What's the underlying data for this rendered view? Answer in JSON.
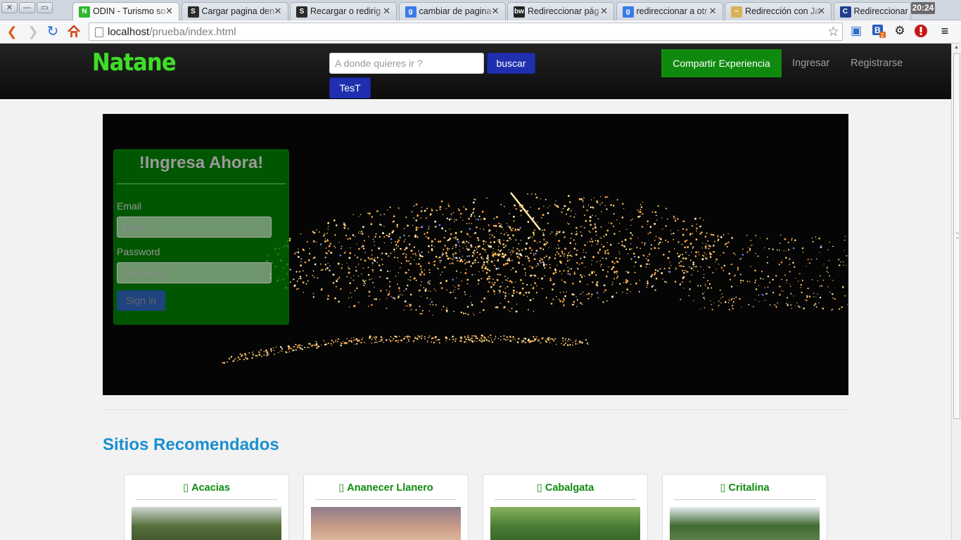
{
  "browser": {
    "tabs": [
      {
        "title": "ODIN - Turismo so",
        "favicon": "N",
        "favicon_color": "#2eb82e",
        "active": true
      },
      {
        "title": "Cargar pagina den",
        "favicon": "S",
        "favicon_color": "#2b2b2b",
        "active": false
      },
      {
        "title": "Recargar o redirig",
        "favicon": "S",
        "favicon_color": "#2b2b2b",
        "active": false
      },
      {
        "title": "cambiar de pagina",
        "favicon": "g",
        "favicon_color": "#3b7be8",
        "active": false
      },
      {
        "title": "Redireccionar pág",
        "favicon": "bw",
        "favicon_color": "#222222",
        "active": false
      },
      {
        "title": "redireccionar a otr",
        "favicon": "g",
        "favicon_color": "#3b7be8",
        "active": false
      },
      {
        "title": "Redirección con Ja",
        "favicon": "~",
        "favicon_color": "#d8b35a",
        "active": false
      },
      {
        "title": "Redireccionar u",
        "favicon": "C",
        "favicon_color": "#1f3f8f",
        "active": false
      }
    ],
    "clock": "20:24",
    "url_host": "localhost",
    "url_path": "/prueba/index.html",
    "window_buttons": {
      "close": "✕",
      "minimize": "—",
      "maximize": "▭"
    },
    "icons": [
      "back-icon",
      "forward-icon",
      "reload-icon",
      "home-icon",
      "bookmark-star-icon",
      "cast-icon",
      "extension-b-icon",
      "settings-icon",
      "stop-icon",
      "menu-icon"
    ]
  },
  "navbar": {
    "brand": "Natane",
    "search_placeholder": "A donde quieres ir ?",
    "search_button": "buscar",
    "test_button": "TesT",
    "share_button": "Compartir Experiencia",
    "login_link": "Ingresar",
    "register_link": "Registrarse"
  },
  "login_form": {
    "title": "!Ingresa Ahora!",
    "email_label": "Email",
    "email_placeholder": "Email",
    "password_label": "Password",
    "password_placeholder": "Password",
    "submit": "Sign in"
  },
  "recommended": {
    "title": "Sitios Recomendados",
    "cards": [
      {
        "name": "Acacias",
        "icon": "map-marker-icon"
      },
      {
        "name": "Ananecer Llanero",
        "icon": "map-marker-icon"
      },
      {
        "name": "Cabalgata",
        "icon": "map-marker-icon"
      },
      {
        "name": "Critalina",
        "icon": "map-marker-icon"
      }
    ]
  },
  "colors": {
    "brand_green": "#3fdd2a",
    "share_green": "#0f8a0f",
    "button_blue": "#1f2fb0",
    "section_title_blue": "#1a8fd1"
  }
}
